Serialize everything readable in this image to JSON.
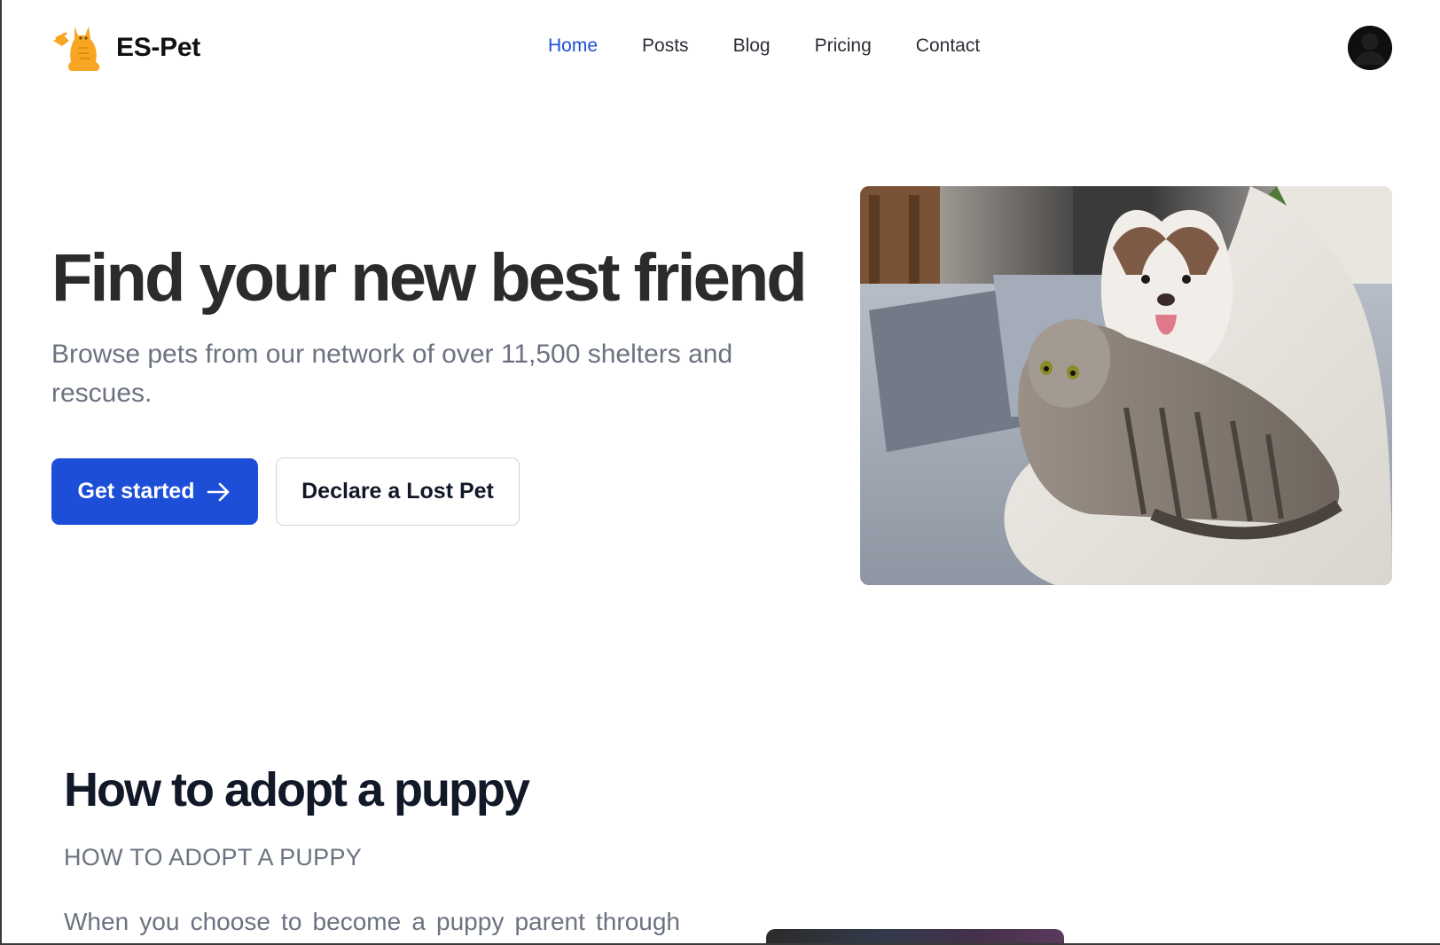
{
  "brand": {
    "name": "ES-Pet",
    "logo_icon": "cat-logo-icon",
    "accent_color": "#1d4ed8"
  },
  "nav": {
    "items": [
      {
        "label": "Home",
        "active": true
      },
      {
        "label": "Posts",
        "active": false
      },
      {
        "label": "Blog",
        "active": false
      },
      {
        "label": "Pricing",
        "active": false
      },
      {
        "label": "Contact",
        "active": false
      }
    ]
  },
  "user": {
    "avatar_icon": "user-avatar-icon"
  },
  "hero": {
    "title": "Find your new best friend",
    "subtitle": "Browse pets from our network of over 11,500 shelters and rescues.",
    "primary_button": "Get started",
    "secondary_button": "Declare a Lost Pet"
  },
  "adopt": {
    "title": "How to adopt a puppy",
    "subtitle": "HOW TO ADOPT A PUPPY",
    "body": "When you choose to become a puppy parent through"
  }
}
